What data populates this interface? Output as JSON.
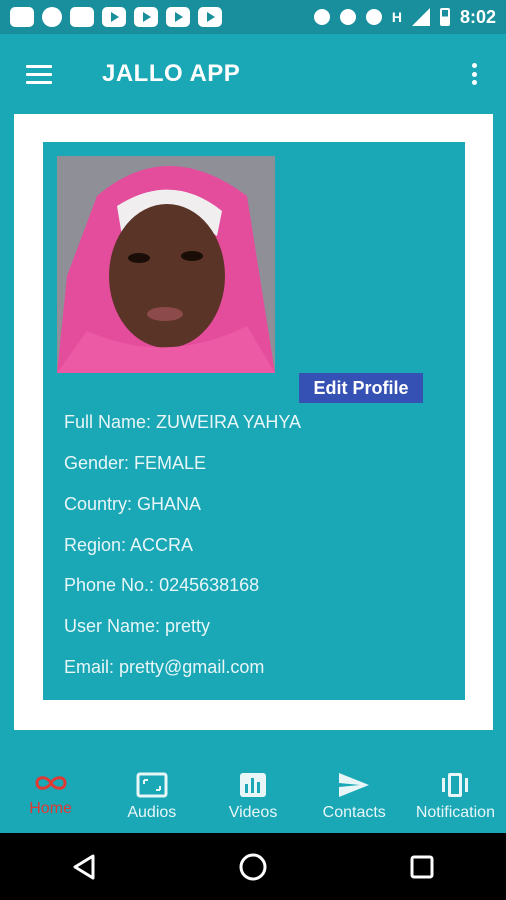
{
  "status_bar": {
    "time": "8:02",
    "network_label": "H"
  },
  "app_bar": {
    "title": "JALLO APP"
  },
  "profile": {
    "edit_label": "Edit Profile",
    "lines": [
      "Full Name: ZUWEIRA YAHYA",
      "Gender: FEMALE",
      "Country: GHANA",
      "Region: ACCRA",
      "Phone No.: 0245638168",
      "User Name: pretty",
      "Email: pretty@gmail.com"
    ]
  },
  "bottom_nav": {
    "items": [
      {
        "label": "Home",
        "icon": "infinity-icon",
        "active": true
      },
      {
        "label": "Audios",
        "icon": "audio-frame-icon",
        "active": false
      },
      {
        "label": "Videos",
        "icon": "bar-chart-icon",
        "active": false
      },
      {
        "label": "Contacts",
        "icon": "send-icon",
        "active": false
      },
      {
        "label": "Notification",
        "icon": "vibrate-icon",
        "active": false
      }
    ]
  },
  "colors": {
    "primary": "#1aa7b6",
    "status_bar": "#198f9e",
    "button": "#3651b4",
    "active_nav": "#e03a35"
  }
}
